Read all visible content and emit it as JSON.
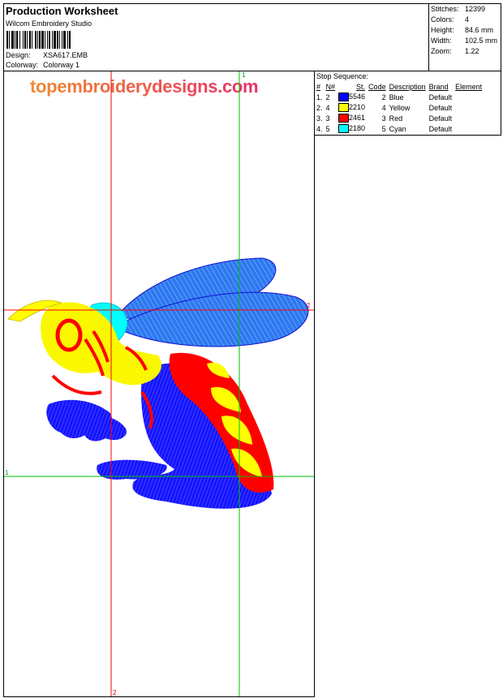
{
  "header": {
    "title": "Production Worksheet",
    "software": "Wilcom Embroidery Studio",
    "design_label": "Design:",
    "design_value": "XSA617.EMB",
    "colorway_label": "Colorway:",
    "colorway_value": "Colorway 1"
  },
  "stats": [
    {
      "label": "Stitches:",
      "value": "12399"
    },
    {
      "label": "Colors:",
      "value": "4"
    },
    {
      "label": "Height:",
      "value": "84.6 mm"
    },
    {
      "label": "Width:",
      "value": "102.5 mm"
    },
    {
      "label": "Zoom:",
      "value": "1.22"
    }
  ],
  "canvas": {
    "watermark": "topembroiderydesigns.com",
    "guide_labels": [
      "1",
      "2",
      "1",
      "2"
    ]
  },
  "stop_sequence": {
    "label": "Stop Sequence:",
    "columns": [
      "#",
      "N#",
      "St.",
      "Code",
      "Description",
      "Brand",
      "Element"
    ],
    "rows": [
      {
        "num": "1.",
        "n": "2",
        "color": "#0000ff",
        "stitches": "5546",
        "code": "2",
        "description": "Blue",
        "brand": "Default",
        "element": ""
      },
      {
        "num": "2.",
        "n": "4",
        "color": "#ffff00",
        "stitches": "2210",
        "code": "4",
        "description": "Yellow",
        "brand": "Default",
        "element": ""
      },
      {
        "num": "3.",
        "n": "3",
        "color": "#ff0000",
        "stitches": "2461",
        "code": "3",
        "description": "Red",
        "brand": "Default",
        "element": ""
      },
      {
        "num": "4.",
        "n": "5",
        "color": "#00ffff",
        "stitches": "2180",
        "code": "5",
        "description": "Cyan",
        "brand": "Default",
        "element": ""
      }
    ]
  },
  "colors": {
    "guide_red": "#ff0000",
    "guide_green": "#00c000",
    "watermark_start": "#f08a30",
    "watermark_end": "#e8306a"
  }
}
